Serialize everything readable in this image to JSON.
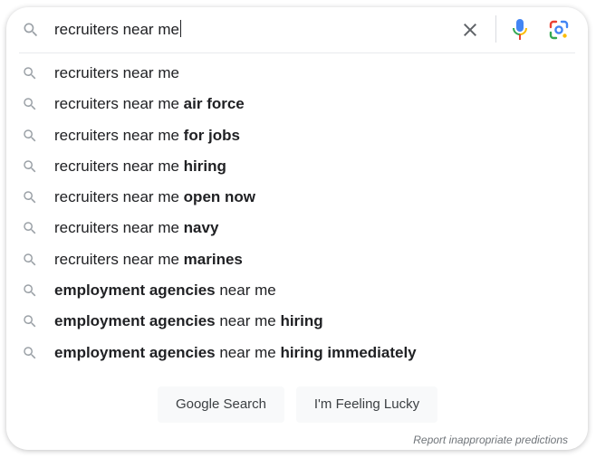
{
  "search": {
    "query": "recruiters near me",
    "clear_icon": "close-icon",
    "voice_icon": "microphone-icon",
    "lens_icon": "google-lens-icon"
  },
  "suggestions": [
    {
      "normal": "recruiters near me",
      "bold": ""
    },
    {
      "normal": "recruiters near me ",
      "bold": "air force"
    },
    {
      "normal": "recruiters near me ",
      "bold": "for jobs"
    },
    {
      "normal": "recruiters near me ",
      "bold": "hiring"
    },
    {
      "normal": "recruiters near me ",
      "bold": "open now"
    },
    {
      "normal": "recruiters near me ",
      "bold": "navy"
    },
    {
      "normal": "recruiters near me ",
      "bold": "marines"
    },
    {
      "bold_prefix": "employment agencies",
      "normal": " near me",
      "bold": ""
    },
    {
      "bold_prefix": "employment agencies",
      "normal": " near me ",
      "bold": "hiring"
    },
    {
      "bold_prefix": "employment agencies",
      "normal": " near me ",
      "bold": "hiring immediately"
    }
  ],
  "buttons": {
    "google_search": "Google Search",
    "feeling_lucky": "I'm Feeling Lucky"
  },
  "report_link": "Report inappropriate predictions",
  "colors": {
    "mic_blue": "#4285f4",
    "mic_red": "#ea4335",
    "mic_yellow": "#fbbc04",
    "mic_green": "#34a853"
  }
}
